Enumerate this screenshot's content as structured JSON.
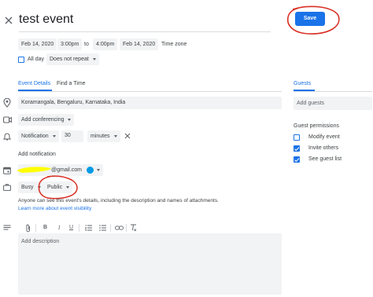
{
  "event": {
    "title": "test event",
    "save_label": "Save",
    "start_date": "Feb 14, 2020",
    "start_time": "3:00pm",
    "to_label": "to",
    "end_time": "4:00pm",
    "end_date": "Feb 14, 2020",
    "timezone_label": "Time zone",
    "all_day_label": "All day",
    "repeat_value": "Does not repeat"
  },
  "tabs": {
    "details": "Event Details",
    "find_time": "Find a Time",
    "guests": "Guests"
  },
  "details": {
    "location": "Koramangala, Bengaluru, Karnataka, India",
    "conferencing": "Add conferencing",
    "notification_type": "Notification",
    "notification_amount": "30",
    "notification_unit": "minutes",
    "add_notification": "Add notification",
    "calendar_email_suffix": "@gmail.com",
    "calendar_color": "#039be5",
    "busy_value": "Busy",
    "visibility_value": "Public",
    "visibility_note": "Anyone can see this event's details, including the description and names of attachments.",
    "learn_more": "Learn more about event visibility",
    "description_placeholder": "Add description"
  },
  "toolbar": {
    "attach_icon": "paperclip-icon",
    "bold": "B",
    "italic": "I",
    "underline": "U"
  },
  "guests": {
    "placeholder": "Add guests",
    "permissions_title": "Guest permissions",
    "permissions": [
      {
        "label": "Modify event",
        "checked": false
      },
      {
        "label": "Invite others",
        "checked": true
      },
      {
        "label": "See guest list",
        "checked": true
      }
    ]
  },
  "colors": {
    "accent": "#1a73e8",
    "annotation": "#d93025",
    "highlight": "#ffff00"
  }
}
